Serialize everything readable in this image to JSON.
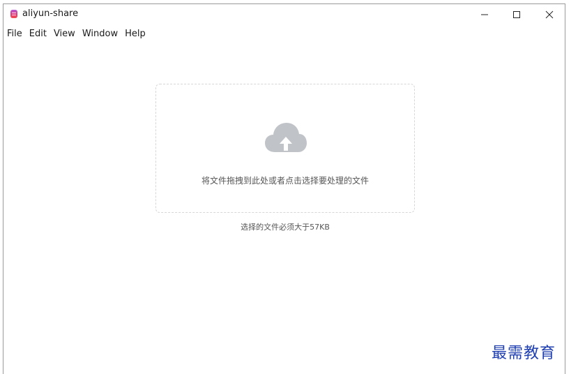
{
  "window": {
    "title": "aliyun-share"
  },
  "menu": {
    "items": [
      "File",
      "Edit",
      "View",
      "Window",
      "Help"
    ]
  },
  "dropzone": {
    "icon": "cloud-upload-icon",
    "text": "将文件拖拽到此处或者点击选择要处理的文件"
  },
  "hint": {
    "text": "选择的文件必须大于57KB"
  },
  "watermark": {
    "text": "最需教育"
  },
  "colors": {
    "icon_gray": "#c0c3c8",
    "watermark_blue": "#1f3fb0"
  }
}
